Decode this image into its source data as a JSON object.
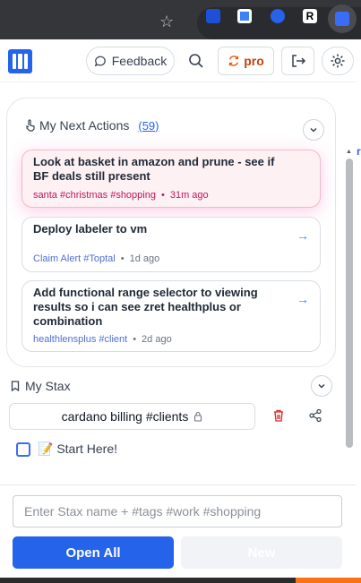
{
  "browser": {
    "star_glyph": "☆",
    "ext_r_label": "R",
    "page_edge_glyph": "r"
  },
  "header": {
    "feedback_label": "Feedback",
    "pro_label": "pro"
  },
  "actions": {
    "title": "My Next Actions",
    "count": "(59)",
    "items": [
      {
        "title": "Look at basket in amazon and prune - see if BF deals still present",
        "tags": "santa #christmas #shopping",
        "age": "31m ago",
        "highlighted": true,
        "arrow": ""
      },
      {
        "title": "Deploy labeler to vm",
        "tags": "Claim Alert #Toptal",
        "age": "1d ago",
        "highlighted": false,
        "arrow": "→"
      },
      {
        "title": "Add functional range selector to viewing results so i can see zret healthplus or combination",
        "tags": "healthlensplus #client",
        "age": "2d ago",
        "highlighted": false,
        "arrow": "→"
      }
    ]
  },
  "stax": {
    "title": "My Stax",
    "item_label": "cardano billing #clients",
    "start_here": "📝 Start Here!"
  },
  "footer": {
    "input_placeholder": "Enter Stax name + #tags #work #shopping",
    "input_value": "",
    "open_all_label": "Open All",
    "new_label": "New"
  },
  "colors": {
    "accent": "#2563eb",
    "pro": "#c2410c",
    "tag_red": "#be185d",
    "tag_blue": "#4f6fd1",
    "trash": "#dc2626"
  },
  "icons": {
    "feedback": "chat-bubble-icon",
    "pro": "refresh-icon",
    "search": "search-icon",
    "logout": "logout-icon",
    "settings": "gear-icon",
    "actions": "pointer-hand-icon",
    "stax": "bookmark-icon",
    "lock": "lock-icon",
    "trash": "trash-icon",
    "share": "share-icon"
  }
}
